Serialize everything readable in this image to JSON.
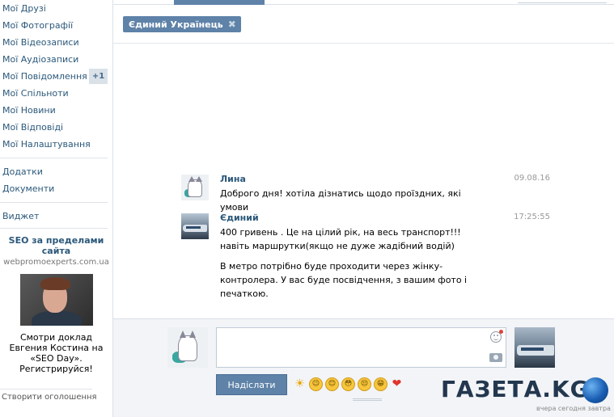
{
  "sidebar": {
    "menu": [
      {
        "label": "Мої Друзі"
      },
      {
        "label": "Мої Фотографії"
      },
      {
        "label": "Мої Відеозаписи"
      },
      {
        "label": "Мої Аудіозаписи"
      },
      {
        "label": "Мої Повідомлення",
        "count": "+1"
      },
      {
        "label": "Мої Спільноти"
      },
      {
        "label": "Мої Новини"
      },
      {
        "label": "Мої Відповіді"
      },
      {
        "label": "Мої Налаштування"
      }
    ],
    "menu2": [
      {
        "label": "Додатки"
      },
      {
        "label": "Документи"
      }
    ],
    "menu3": [
      {
        "label": "Виджет"
      }
    ],
    "ad": {
      "title": "SEO за пределами сайта",
      "domain": "webpromoexperts.com.ua",
      "text": "Смотри доклад Евгения Костина на «SEO Day». Регистрируйся!"
    },
    "create_ad": "Створити оголошення"
  },
  "conversation": {
    "tag_label": "Єдиний Українець",
    "messages": [
      {
        "author": "Лина",
        "time": "09.08.16",
        "texts": [
          "Доброго дня! хотіла дізнатись щодо проїздних, які умови"
        ]
      },
      {
        "author": "Єдиний",
        "time": "17:25:55",
        "texts": [
          "400 гривень . Це на цілий рік, на весь транспорт!!! навіть маршрутки(якщо не дуже жадібний водій)",
          "В метро потрібно буде проходити через жінку-контролера. У вас буде посвідчення, з вашим фото і печаткою."
        ]
      }
    ]
  },
  "composer": {
    "placeholder": "",
    "send_label": "Надіслати",
    "emojis": [
      "☀",
      "😉",
      "😊",
      "😳",
      "😒",
      "😁",
      "❤"
    ]
  },
  "watermark": {
    "logo": "ГАЗЕТА.KG",
    "tagline": "вчера сегодня завтра"
  },
  "colors": {
    "link": "#2b587a",
    "accent": "#5e82a8",
    "badge_bg": "#dae2e8",
    "composer_bg": "#f2f4f7"
  }
}
